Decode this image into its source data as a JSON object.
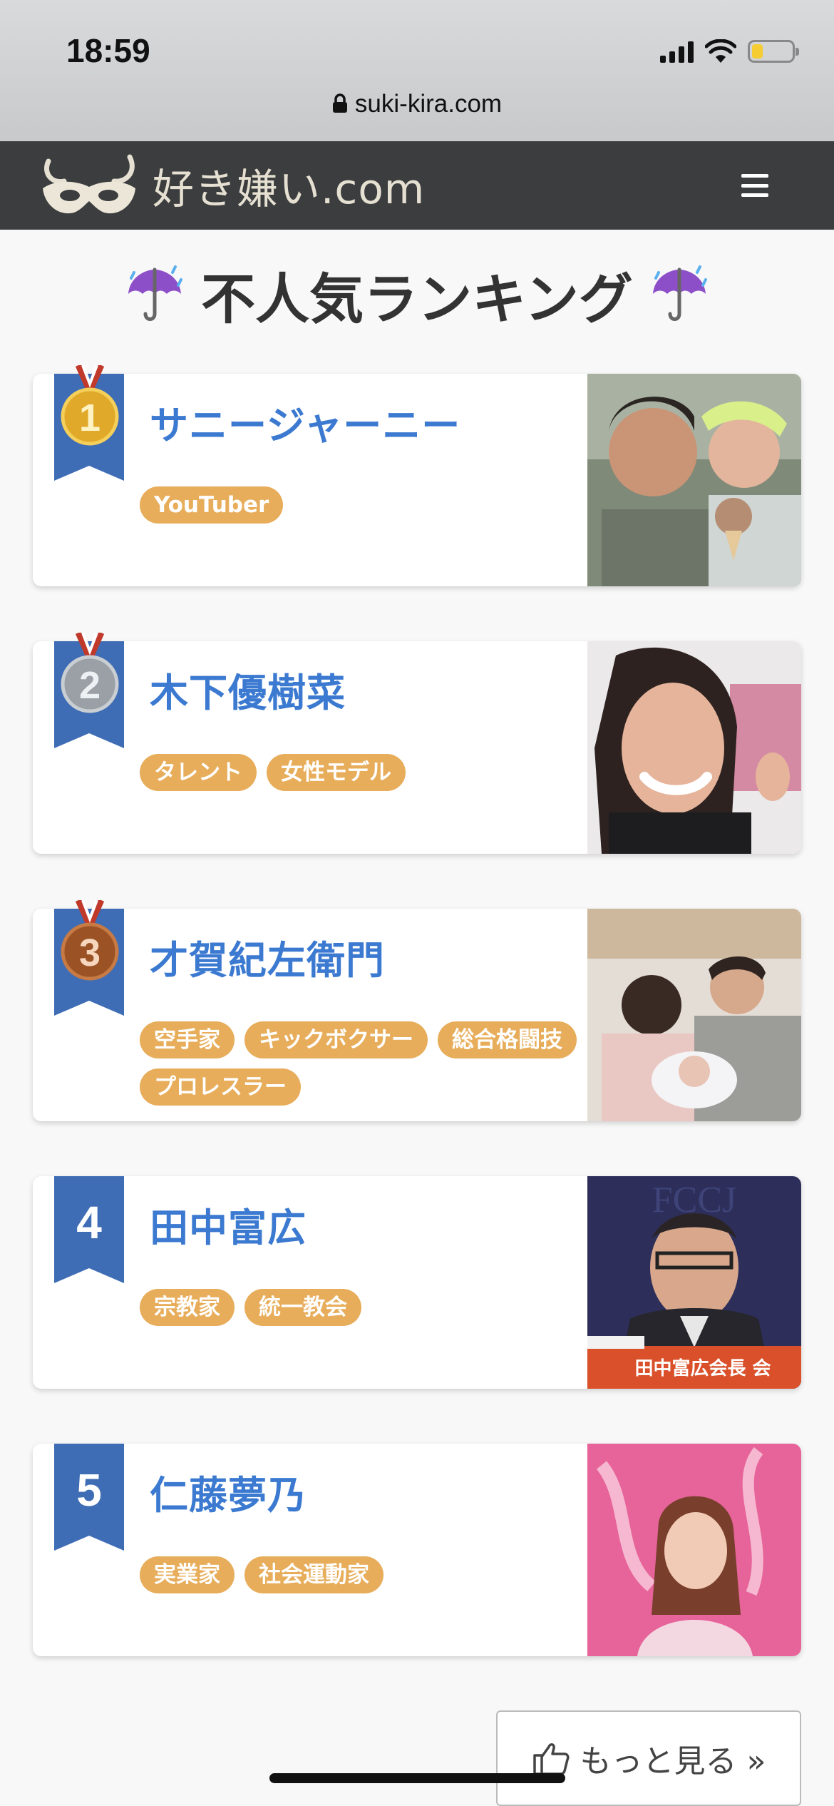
{
  "status": {
    "time": "18:59",
    "url": "suki-kira.com"
  },
  "header": {
    "logo_text": "好き嫌い.com"
  },
  "page": {
    "title": "不人気ランキング"
  },
  "rankings": [
    {
      "rank": "1",
      "name": "サニージャーニー",
      "tags": [
        "YouTuber"
      ]
    },
    {
      "rank": "2",
      "name": "木下優樹菜",
      "tags": [
        "タレント",
        "女性モデル"
      ]
    },
    {
      "rank": "3",
      "name": "才賀紀左衛門",
      "tags": [
        "空手家",
        "キックボクサー",
        "総合格闘技",
        "プロレスラー"
      ]
    },
    {
      "rank": "4",
      "name": "田中富広",
      "tags": [
        "宗教家",
        "統一教会"
      ],
      "photo_caption": "田中富広会長 会"
    },
    {
      "rank": "5",
      "name": "仁藤夢乃",
      "tags": [
        "実業家",
        "社会運動家"
      ]
    }
  ],
  "more_button": {
    "label": "もっと見る »"
  },
  "colors": {
    "header_bg": "#3b3d3e",
    "name_link": "#3b7ad0",
    "tag_bg": "#e7ad5b",
    "ribbon": "#3f6db5"
  }
}
